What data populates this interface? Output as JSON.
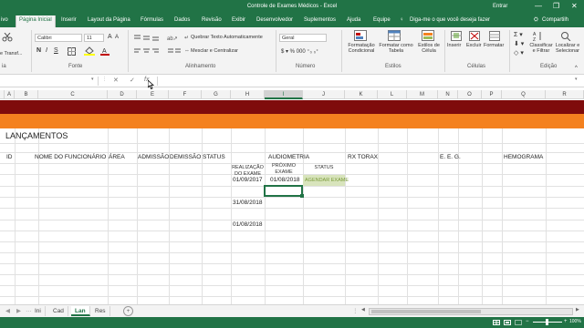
{
  "window": {
    "title": "Controle de Exames Médicos  -  Excel",
    "signin": "Entrar",
    "minimize": "—",
    "restore": "❐",
    "close": "✕"
  },
  "ribbon_tabs": [
    "ivo",
    "Página Inicial",
    "Inserir",
    "Layout da Página",
    "Fórmulas",
    "Dados",
    "Revisão",
    "Exibir",
    "Desenvolvedor",
    "Suplementos",
    "Ajuda",
    "Equipe"
  ],
  "tell_me": "Diga-me o que você deseja fazer",
  "share": "Compartilh",
  "ribbon": {
    "format_painter": "e Transf...",
    "font_name": "Calibri",
    "font_size": "11",
    "bold": "N",
    "italic": "I",
    "underline": "S",
    "wrap_text": "Quebrar Texto Automaticamente",
    "merge_center": "Mesclar e Centralizar",
    "number_format": "Geral",
    "cond_format": [
      "Formatação",
      "Condicional"
    ],
    "format_table": [
      "Formatar como",
      "Tabela"
    ],
    "cell_styles": [
      "Estilos de",
      "Célula"
    ],
    "insert": "Inserir",
    "delete": "Excluir",
    "format": "Formatar",
    "sort_filter": [
      "Classificar",
      "e Filtrar"
    ],
    "find_select": [
      "Localizar e",
      "Selecionar"
    ],
    "groups": {
      "clipboard": "ia",
      "font": "Fonte",
      "alignment": "Alinhamento",
      "number": "Número",
      "styles": "Estilos",
      "cells": "Células",
      "editing": "Edição"
    }
  },
  "formula_bar": {
    "cell_ref": "",
    "cancel": "✕",
    "enter": "✓",
    "fx": "fx",
    "value": ""
  },
  "columns": [
    "A",
    "B",
    "C",
    "D",
    "E",
    "F",
    "G",
    "H",
    "I",
    "J",
    "K",
    "L",
    "M",
    "N",
    "O",
    "P",
    "Q",
    "R"
  ],
  "selected_column": "I",
  "sheet": {
    "heading": "LANÇAMENTOS",
    "headers": {
      "id": "ID",
      "name": "NOME DO FUNCIONÁRIO",
      "area": "ÁREA",
      "admission": "ADMISSÃO",
      "dismissal": "DEMISSÃO",
      "status": "STATUS",
      "audiometry": "AUDIOMETRIA",
      "xray": "RX TORAX",
      "eeg": "E. E. G.",
      "blood": "HEMOGRAMA"
    },
    "sub_headers": {
      "realization": [
        "REALIZAÇÃO",
        "DO EXAME"
      ],
      "next": [
        "PRÓXIMO",
        "EXAME"
      ],
      "status": "STATUS"
    },
    "rows": [
      {
        "realization": "01/09/2017",
        "next": "01/08/2018",
        "status": "AGENDAR EXAME"
      },
      {
        "realization": "31/08/2018",
        "next": "",
        "status": ""
      },
      {
        "realization": "01/08/2018",
        "next": "",
        "status": ""
      }
    ]
  },
  "sheet_tabs": [
    "Ini",
    "Cad",
    "Lan",
    "Res"
  ],
  "active_sheet": "Lan",
  "add_sheet": "+",
  "zoom": "100%",
  "colors": {
    "excel_green": "#217346",
    "band_dark_red": "#7f0c0c",
    "band_orange": "#f4811f",
    "status_fill": "#d8e4bc"
  }
}
